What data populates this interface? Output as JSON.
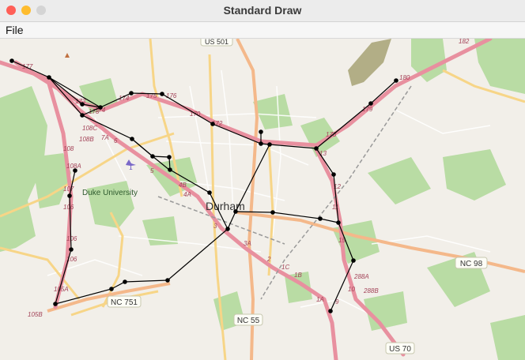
{
  "window": {
    "title": "Standard Draw"
  },
  "menu": {
    "file": "File"
  },
  "map": {
    "city": "Durham",
    "university": "Duke University",
    "shields": [
      "US 501",
      "NC 98",
      "NC 751",
      "NC 55",
      "US 70"
    ],
    "exits": [
      "177",
      "173",
      "175",
      "174",
      "176",
      "170",
      "172",
      "108",
      "107",
      "106",
      "105A",
      "105B",
      "108C",
      "108B",
      "108A",
      "7A",
      "6",
      "5",
      "4B",
      "4A",
      "3",
      "3A",
      "2",
      "1C",
      "1B",
      "1A",
      "12",
      "11",
      "13",
      "15",
      "9",
      "10",
      "288A",
      "288B",
      "178",
      "179",
      "180",
      "182"
    ]
  },
  "colors": {
    "edge": "#000000",
    "vertex": "#000000",
    "motorway": "#e8909f",
    "trunk": "#f4b88a",
    "primary": "#f7d587"
  }
}
